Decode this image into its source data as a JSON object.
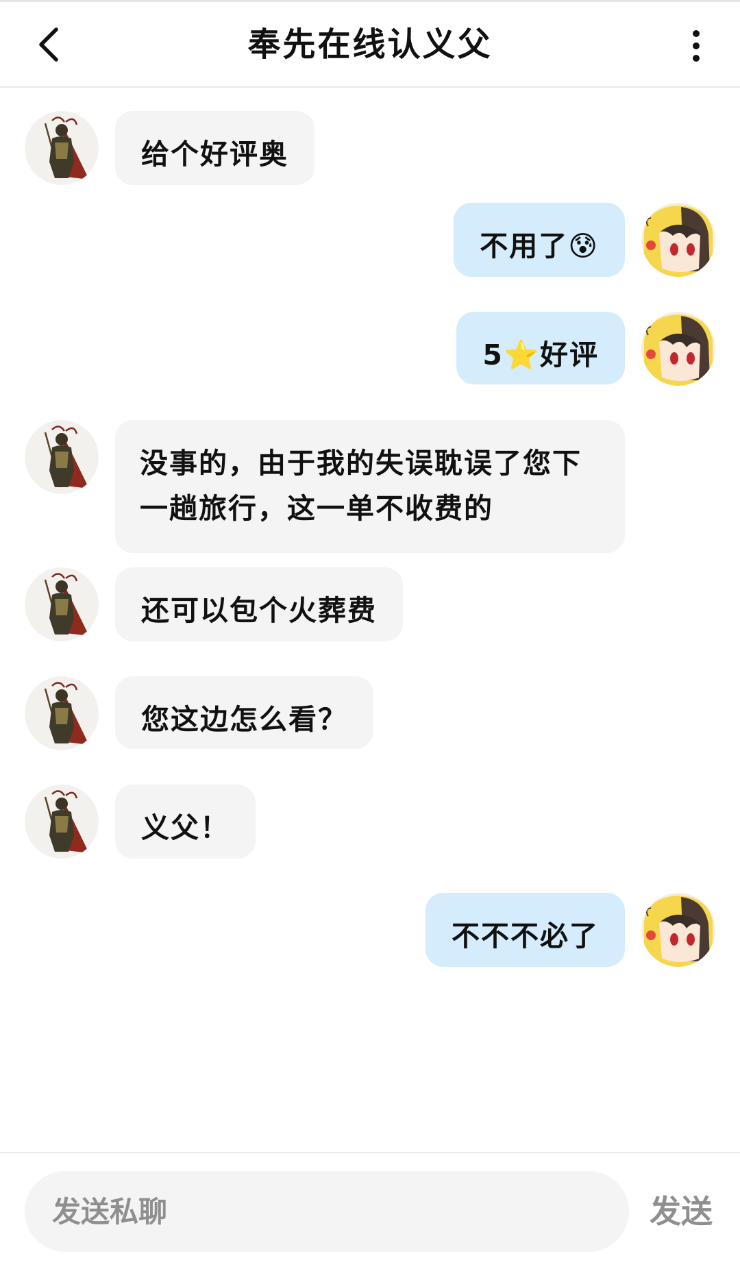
{
  "header": {
    "title": "奉先在线认义父",
    "back_icon": "chevron-left-icon",
    "more_icon": "more-vertical-icon"
  },
  "contacts": {
    "other": {
      "avatar_icon": "warrior-avatar"
    },
    "self": {
      "avatar_icon": "pikachu-hood-avatar"
    }
  },
  "messages": [
    {
      "sender": "other",
      "text": "给个好评奥"
    },
    {
      "sender": "self",
      "text": "不用了😰"
    },
    {
      "sender": "self",
      "text": "5⭐好评"
    },
    {
      "sender": "other",
      "text": "没事的，由于我的失误耽误了您下一趟旅行，这一单不收费的"
    },
    {
      "sender": "other",
      "text": "还可以包个火葬费"
    },
    {
      "sender": "other",
      "text": "您这边怎么看？"
    },
    {
      "sender": "other",
      "text": "义父！"
    },
    {
      "sender": "self",
      "text": "不不不必了"
    }
  ],
  "composer": {
    "placeholder": "发送私聊",
    "value": "",
    "send_label": "发送"
  },
  "colors": {
    "incoming_bubble": "#f4f4f4",
    "outgoing_bubble": "#d4ecfb",
    "send_label": "#8f8f8f"
  }
}
